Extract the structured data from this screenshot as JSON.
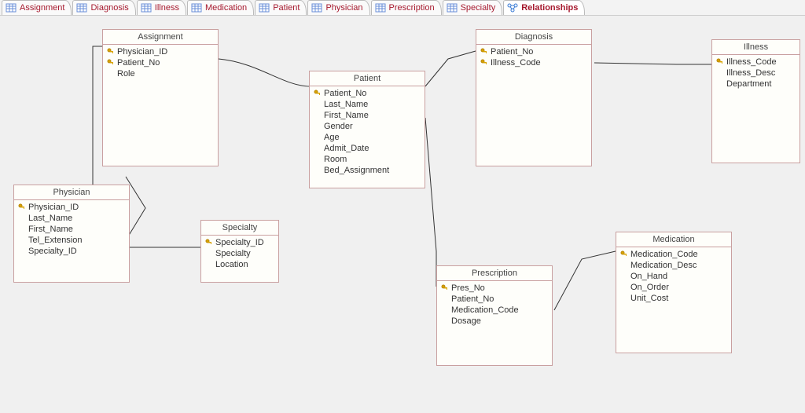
{
  "tabs": [
    {
      "label": "Assignment",
      "type": "table"
    },
    {
      "label": "Diagnosis",
      "type": "table"
    },
    {
      "label": "Illness",
      "type": "table"
    },
    {
      "label": "Medication",
      "type": "table"
    },
    {
      "label": "Patient",
      "type": "table"
    },
    {
      "label": "Physician",
      "type": "table"
    },
    {
      "label": "Prescription",
      "type": "table"
    },
    {
      "label": "Specialty",
      "type": "table"
    },
    {
      "label": "Relationships",
      "type": "relationships",
      "active": true
    }
  ],
  "entities": {
    "assignment": {
      "title": "Assignment",
      "fields": [
        {
          "name": "Physician_ID",
          "pk": true
        },
        {
          "name": "Patient_No",
          "pk": true
        },
        {
          "name": "Role",
          "pk": false
        }
      ]
    },
    "physician": {
      "title": "Physician",
      "fields": [
        {
          "name": "Physician_ID",
          "pk": true
        },
        {
          "name": "Last_Name",
          "pk": false
        },
        {
          "name": "First_Name",
          "pk": false
        },
        {
          "name": "Tel_Extension",
          "pk": false
        },
        {
          "name": "Specialty_ID",
          "pk": false
        }
      ]
    },
    "specialty": {
      "title": "Specialty",
      "fields": [
        {
          "name": "Specialty_ID",
          "pk": true
        },
        {
          "name": "Specialty",
          "pk": false
        },
        {
          "name": "Location",
          "pk": false
        }
      ]
    },
    "patient": {
      "title": "Patient",
      "fields": [
        {
          "name": "Patient_No",
          "pk": true
        },
        {
          "name": "Last_Name",
          "pk": false
        },
        {
          "name": "First_Name",
          "pk": false
        },
        {
          "name": "Gender",
          "pk": false
        },
        {
          "name": "Age",
          "pk": false
        },
        {
          "name": "Admit_Date",
          "pk": false
        },
        {
          "name": "Room",
          "pk": false
        },
        {
          "name": "Bed_Assignment",
          "pk": false
        }
      ]
    },
    "diagnosis": {
      "title": "Diagnosis",
      "fields": [
        {
          "name": "Patient_No",
          "pk": true
        },
        {
          "name": "Illness_Code",
          "pk": true
        }
      ]
    },
    "illness": {
      "title": "Illness",
      "fields": [
        {
          "name": "Illness_Code",
          "pk": true
        },
        {
          "name": "Illness_Desc",
          "pk": false
        },
        {
          "name": "Department",
          "pk": false
        }
      ]
    },
    "prescription": {
      "title": "Prescription",
      "fields": [
        {
          "name": "Pres_No",
          "pk": true
        },
        {
          "name": "Patient_No",
          "pk": false
        },
        {
          "name": "Medication_Code",
          "pk": false
        },
        {
          "name": "Dosage",
          "pk": false
        }
      ]
    },
    "medication": {
      "title": "Medication",
      "fields": [
        {
          "name": "Medication_Code",
          "pk": true
        },
        {
          "name": "Medication_Desc",
          "pk": false
        },
        {
          "name": "On_Hand",
          "pk": false
        },
        {
          "name": "On_Order",
          "pk": false
        },
        {
          "name": "Unit_Cost",
          "pk": false
        }
      ]
    }
  },
  "relationships": [
    {
      "from": "physician.Physician_ID",
      "to": "assignment.Physician_ID"
    },
    {
      "from": "patient.Patient_No",
      "to": "assignment.Patient_No"
    },
    {
      "from": "specialty.Specialty_ID",
      "to": "physician.Specialty_ID"
    },
    {
      "from": "patient.Patient_No",
      "to": "diagnosis.Patient_No"
    },
    {
      "from": "illness.Illness_Code",
      "to": "diagnosis.Illness_Code"
    },
    {
      "from": "patient.Patient_No",
      "to": "prescription.Patient_No"
    },
    {
      "from": "medication.Medication_Code",
      "to": "prescription.Medication_Code"
    }
  ],
  "colors": {
    "tab_text": "#a6192e",
    "entity_border": "#c9a0a0",
    "canvas_bg": "#f0f0f0"
  }
}
